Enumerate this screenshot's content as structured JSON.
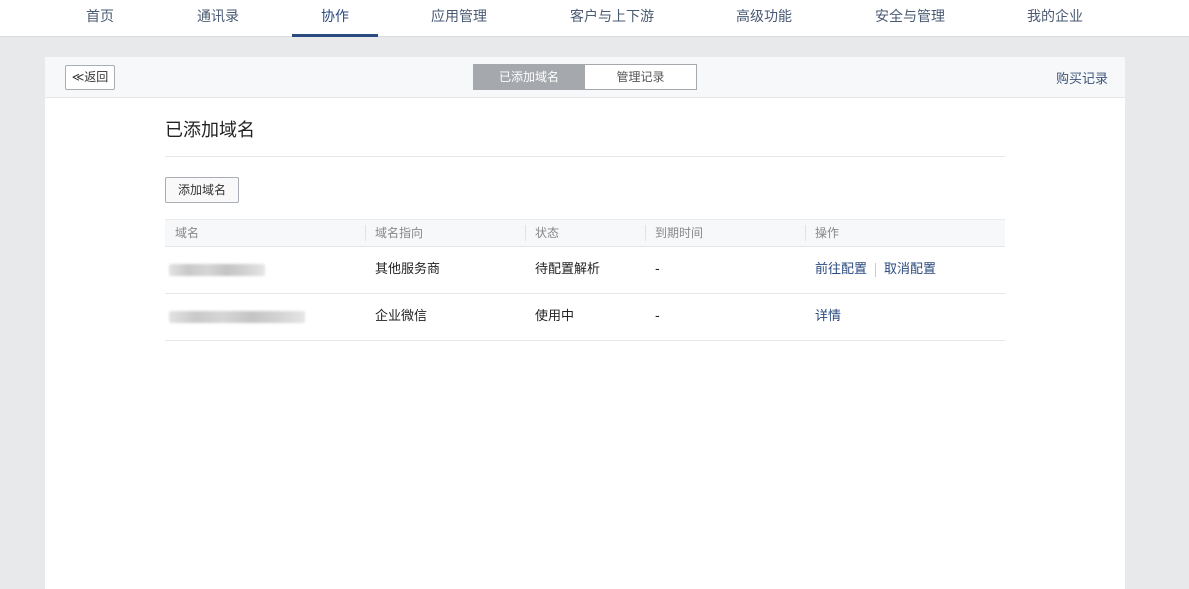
{
  "nav": {
    "items": [
      {
        "label": "首页"
      },
      {
        "label": "通讯录"
      },
      {
        "label": "协作"
      },
      {
        "label": "应用管理"
      },
      {
        "label": "客户与上下游"
      },
      {
        "label": "高级功能"
      },
      {
        "label": "安全与管理"
      },
      {
        "label": "我的企业"
      }
    ],
    "active": "协作"
  },
  "header": {
    "back_label": "≪返回",
    "tabs": [
      {
        "label": "已添加域名",
        "selected": true
      },
      {
        "label": "管理记录",
        "selected": false
      }
    ],
    "buy_record_label": "购买记录"
  },
  "main": {
    "title": "已添加域名",
    "add_button_label": "添加域名",
    "table": {
      "columns": [
        "域名",
        "域名指向",
        "状态",
        "到期时间",
        "操作"
      ],
      "rows": [
        {
          "domain": "",
          "target": "其他服务商",
          "status": "待配置解析",
          "expiry": "-",
          "actions": [
            "前往配置",
            "取消配置"
          ]
        },
        {
          "domain": "",
          "target": "企业微信",
          "status": "使用中",
          "expiry": "-",
          "actions": [
            "详情"
          ]
        }
      ]
    }
  },
  "colors": {
    "accent": "#2b4a7e",
    "nav_text": "#4a5a73",
    "background": "#e8e9eb",
    "segment_selected": "#a5a8ad"
  }
}
